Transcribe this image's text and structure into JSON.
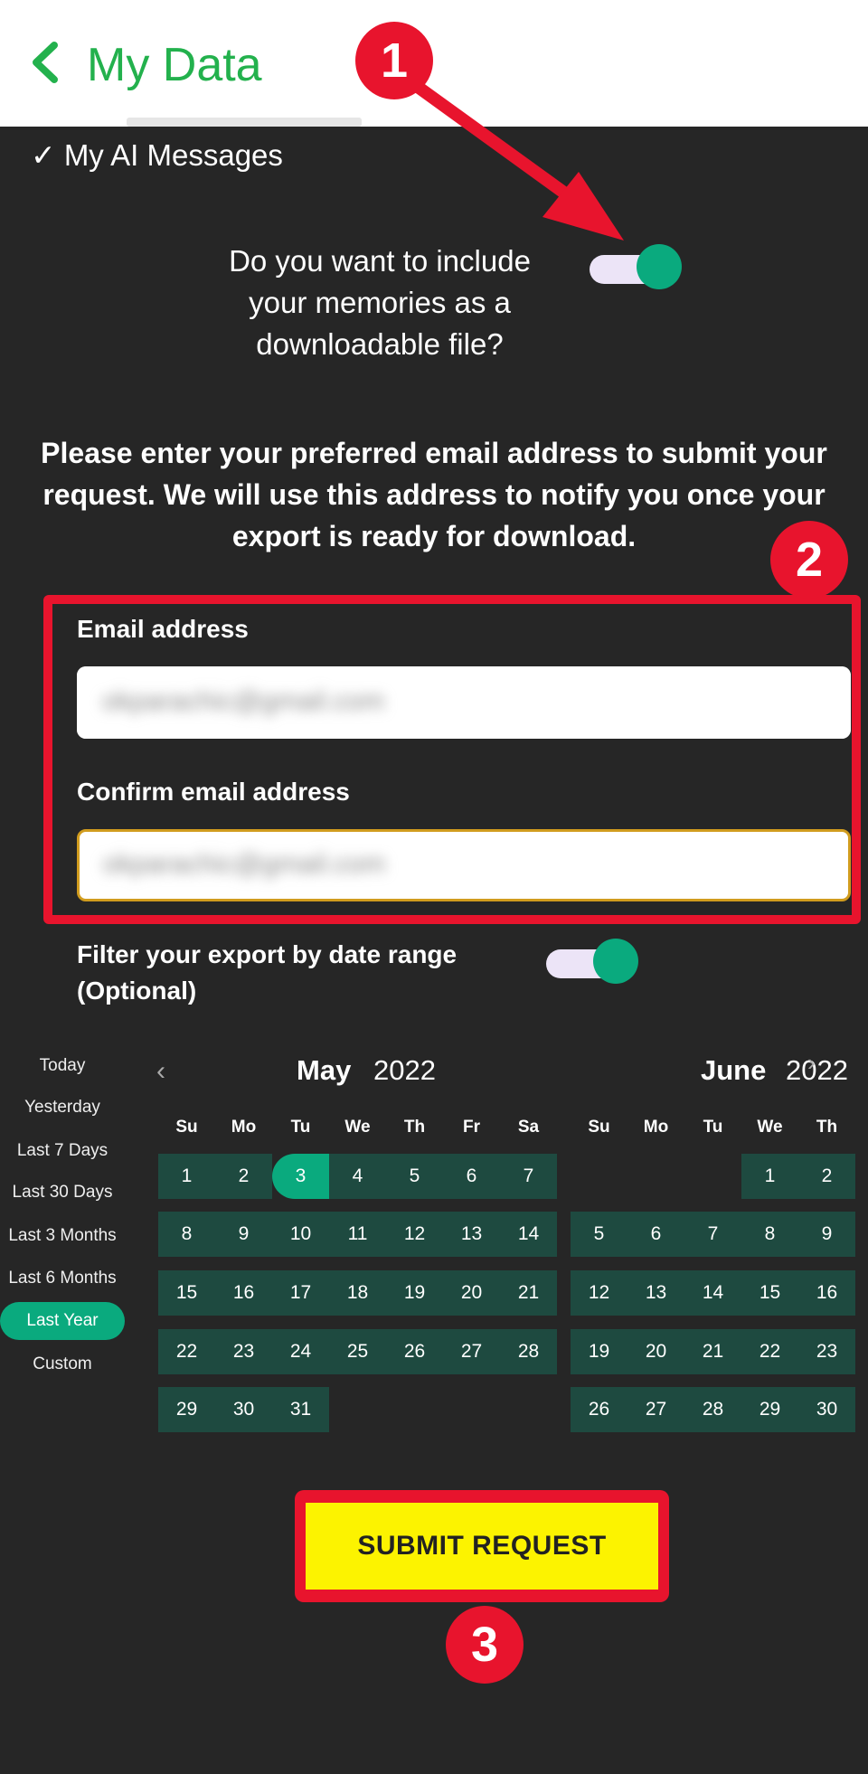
{
  "header": {
    "title": "My Data"
  },
  "checklist": {
    "item": "✓ My AI Messages"
  },
  "memories": {
    "question": "Do you want to include your memories as a downloadable file?",
    "enabled": true
  },
  "info_text": "Please enter your preferred email address to submit your request. We will use this address to notify you once your export is ready for download.",
  "email": {
    "label": "Email address",
    "value": "okparachic@gmail.com",
    "confirm_label": "Confirm email address",
    "confirm_value": "okparachic@gmail.com"
  },
  "filter": {
    "label": "Filter your export by date range (Optional)",
    "enabled": true
  },
  "presets": [
    "Today",
    "Yesterday",
    "Last 7 Days",
    "Last 30 Days",
    "Last 3 Months",
    "Last 6 Months",
    "Last Year",
    "Custom"
  ],
  "active_preset": "Last Year",
  "calendar": {
    "left": {
      "month": "May",
      "year": "2022",
      "weekdays": [
        "Su",
        "Mo",
        "Tu",
        "We",
        "Th",
        "Fr",
        "Sa"
      ],
      "weeks": [
        [
          "1",
          "2",
          "3",
          "4",
          "5",
          "6",
          "7"
        ],
        [
          "8",
          "9",
          "10",
          "11",
          "12",
          "13",
          "14"
        ],
        [
          "15",
          "16",
          "17",
          "18",
          "19",
          "20",
          "21"
        ],
        [
          "22",
          "23",
          "24",
          "25",
          "26",
          "27",
          "28"
        ],
        [
          "29",
          "30",
          "31",
          "",
          "",
          "",
          ""
        ]
      ],
      "selected_day": "3"
    },
    "right": {
      "month": "June",
      "year": "2022",
      "weekdays": [
        "Su",
        "Mo",
        "Tu",
        "We",
        "Th"
      ],
      "weeks": [
        [
          "",
          "",
          "",
          "1",
          "2"
        ],
        [
          "5",
          "6",
          "7",
          "8",
          "9"
        ],
        [
          "12",
          "13",
          "14",
          "15",
          "16"
        ],
        [
          "19",
          "20",
          "21",
          "22",
          "23"
        ],
        [
          "26",
          "27",
          "28",
          "29",
          "30"
        ]
      ]
    }
  },
  "submit": {
    "label": "SUBMIT REQUEST"
  },
  "annotations": {
    "marker1": "1",
    "marker2": "2",
    "marker3": "3"
  },
  "colors": {
    "accent_green": "#0aaa7e",
    "header_green": "#23b14d",
    "annotation_red": "#e8142d",
    "submit_yellow": "#fcf300",
    "background": "#262626"
  }
}
